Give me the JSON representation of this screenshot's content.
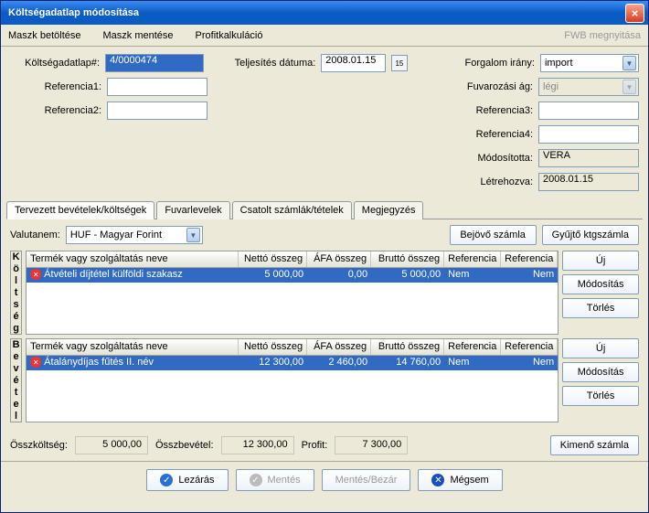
{
  "window": {
    "title": "Költségadatlap módosítása"
  },
  "menu": {
    "load": "Maszk betöltése",
    "save": "Maszk mentése",
    "profit": "Profitkalkuláció",
    "fwb": "FWB megnyitása"
  },
  "labels": {
    "sheetno": "Költségadatlap#:",
    "ref1": "Referencia1:",
    "ref2": "Referencia2:",
    "date": "Teljesítés dátuma:",
    "dir": "Forgalom irány:",
    "branch": "Fuvarozási ág:",
    "ref3": "Referencia3:",
    "ref4": "Referencia4:",
    "modby": "Módosította:",
    "created": "Létrehozva:",
    "currency": "Valutanem:"
  },
  "values": {
    "sheetno": "4/0000474",
    "date": "2008.01.15",
    "dir": "import",
    "branch": "légi",
    "modby": "VERA",
    "created": "2008.01.15",
    "currency": "HUF - Magyar Forint"
  },
  "tabs": {
    "t1": "Tervezett bevételek/költségek",
    "t2": "Fuvarlevelek",
    "t3": "Csatolt számlák/tételek",
    "t4": "Megjegyzés"
  },
  "headers": {
    "name": "Termék vagy szolgáltatás neve",
    "net": "Nettó összeg",
    "vat": "ÁFA összeg",
    "gross": "Bruttó összeg",
    "refa": "Referencia",
    "refb": "Referencia"
  },
  "cost_row": {
    "name": "Átvételi díjtétel külföldi szakasz",
    "net": "5 000,00",
    "vat": "0,00",
    "gross": "5 000,00",
    "refa": "Nem",
    "refb": "Nem"
  },
  "rev_row": {
    "name": "Átalánydíjas fűtés II. név",
    "net": "12 300,00",
    "vat": "2 460,00",
    "gross": "14 760,00",
    "refa": "Nem",
    "refb": "Nem"
  },
  "side": {
    "cost": "Költség",
    "rev": "Bevétel"
  },
  "buttons": {
    "incoming": "Bejövő számla",
    "collect": "Gyűjtő ktgszámla",
    "new": "Új",
    "edit": "Módosítás",
    "del": "Törlés",
    "outgoing": "Kimenő számla",
    "close_ok": "Lezárás",
    "save": "Mentés",
    "saveclose": "Mentés/Bezár",
    "cancel": "Mégsem"
  },
  "totals": {
    "costlbl": "Összköltség:",
    "cost": "5 000,00",
    "revlbl": "Összbevétel:",
    "rev": "12 300,00",
    "profitlbl": "Profit:",
    "profit": "7 300,00"
  }
}
